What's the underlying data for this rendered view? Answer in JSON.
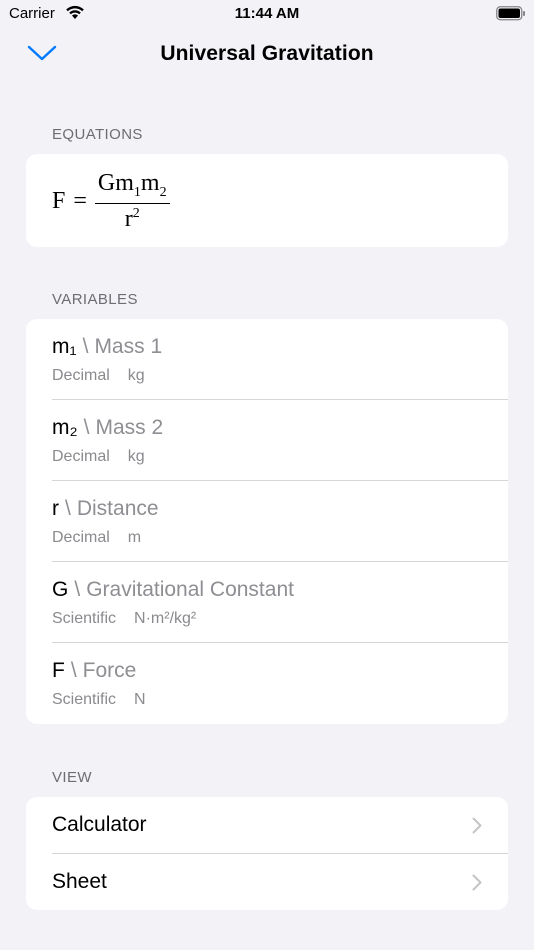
{
  "status_bar": {
    "carrier": "Carrier",
    "time": "11:44 AM"
  },
  "nav": {
    "title": "Universal Gravitation"
  },
  "equations": {
    "header": "EQUATIONS",
    "lhs": "F",
    "equals": "=",
    "numerator_base": "Gm",
    "numerator_sub1": "1",
    "numerator_m": "m",
    "numerator_sub2": "2",
    "denominator_base": "r",
    "denominator_sup": "2"
  },
  "variables": {
    "header": "VARIABLES",
    "separator": "\\",
    "items": [
      {
        "symbol": "m₁",
        "name": "Mass 1",
        "type": "Decimal",
        "unit": "kg"
      },
      {
        "symbol": "m₂",
        "name": "Mass 2",
        "type": "Decimal",
        "unit": "kg"
      },
      {
        "symbol": "r",
        "name": "Distance",
        "type": "Decimal",
        "unit": "m"
      },
      {
        "symbol": "G",
        "name": "Gravitational Constant",
        "type": "Scientific",
        "unit": "N·m²/kg²"
      },
      {
        "symbol": "F",
        "name": "Force",
        "type": "Scientific",
        "unit": "N"
      }
    ]
  },
  "view": {
    "header": "VIEW",
    "items": [
      {
        "label": "Calculator"
      },
      {
        "label": "Sheet"
      }
    ]
  },
  "colors": {
    "accent": "#007aff",
    "background": "#f2f2f7",
    "secondary_text": "#8e8e93"
  },
  "icons": {
    "back": "chevron-down-icon",
    "row": "chevron-right-icon",
    "wifi": "wifi-icon",
    "battery": "battery-icon"
  }
}
